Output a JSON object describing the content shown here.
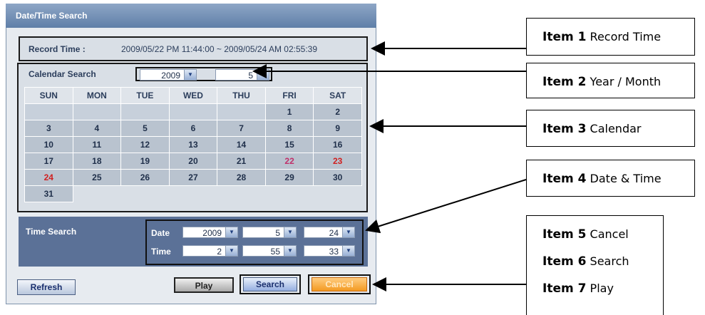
{
  "dialog": {
    "title": "Date/Time Search",
    "record": {
      "label": "Record Time :",
      "value": "2009/05/22 PM 11:44:00 ~ 2009/05/24 AM 02:55:39"
    },
    "calendar": {
      "label": "Calendar Search",
      "year": "2009",
      "month": "5",
      "weekdays": [
        "SUN",
        "MON",
        "TUE",
        "WED",
        "THU",
        "FRI",
        "SAT"
      ],
      "weeks": [
        [
          "",
          "",
          "",
          "",
          "",
          "1",
          "2"
        ],
        [
          "3",
          "4",
          "5",
          "6",
          "7",
          "8",
          "9"
        ],
        [
          "10",
          "11",
          "12",
          "13",
          "14",
          "15",
          "16"
        ],
        [
          "17",
          "18",
          "19",
          "20",
          "21",
          "22",
          "23"
        ],
        [
          "24",
          "25",
          "26",
          "27",
          "28",
          "29",
          "30"
        ],
        [
          "31",
          "",
          "",
          "",
          "",
          "",
          ""
        ]
      ],
      "highlight": {
        "22": "#c0306a",
        "23": "#d02020",
        "24": "#d02020"
      },
      "default_day_color": "#1f2f4a"
    },
    "time_search": {
      "label": "Time Search",
      "date_label": "Date",
      "time_label": "Time",
      "date": {
        "year": "2009",
        "month": "5",
        "day": "24"
      },
      "time": {
        "hour": "2",
        "minute": "55",
        "second": "33"
      }
    },
    "buttons": {
      "refresh": "Refresh",
      "play": "Play",
      "search": "Search",
      "cancel": "Cancel"
    }
  },
  "callouts": [
    {
      "bold": "Item 1",
      "text": " Record Time"
    },
    {
      "bold": "Item 2",
      "text": " Year / Month"
    },
    {
      "bold": "Item 3",
      "text": " Calendar"
    },
    {
      "bold": "Item 4",
      "text": " Date & Time"
    },
    {
      "bold": "Item 5",
      "text": " Cancel"
    },
    {
      "bold": "Item 6",
      "text": " Search"
    },
    {
      "bold": "Item 7",
      "text": " Play"
    }
  ],
  "colors": {
    "accent": "#5b7197",
    "cancel": "#f39a22"
  }
}
